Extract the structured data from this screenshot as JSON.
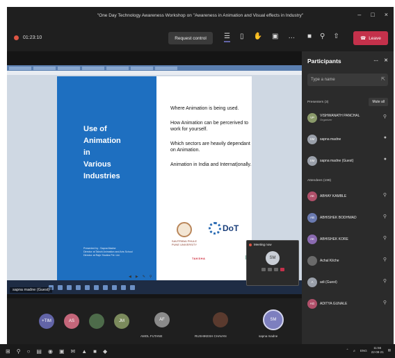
{
  "window": {
    "title": "\"One Day Technology Awareness Workshop on \"Awareness in Animation and Visual effects in Industry\"",
    "controls": [
      "–",
      "□",
      "×"
    ]
  },
  "toolbar": {
    "timer": "01:23:10",
    "request_control": "Request control",
    "leave": "Leave"
  },
  "slide": {
    "title_lines": [
      "Use of",
      "Animation",
      "in",
      "Various",
      "Industries"
    ],
    "bullets": [
      "Where Animation is being used.",
      "How Animation can be percerived to work for yourself.",
      "Which sectors are heavily dependant on Animation.",
      "Animation in India and Internat|onally."
    ],
    "presenter_lines": [
      "Presented by : Sapna Madne",
      "Director at Takshi Animation and Arts School",
      "Director at Rajrr Studios Pvt. Ltd."
    ],
    "ssp_lines": [
      "SAVITRIBAI PHULE",
      "PUNE UNIVERSITY"
    ],
    "dot_text": "DoT",
    "tak_text": "TAKSHA"
  },
  "stage": {
    "name_tag": "sapna madne (Guest)"
  },
  "meet_now": {
    "title": "Meeting now",
    "avatar": "SM"
  },
  "bottom": {
    "avatars": [
      {
        "initials": "+TIM",
        "color": "#6264a7"
      },
      {
        "initials": "AS",
        "color": "#c4667a"
      },
      {
        "initials": "",
        "color": "#4d6b4a"
      },
      {
        "initials": "JM",
        "color": "#7b8a5c"
      }
    ],
    "tiles": [
      {
        "initials": "AF",
        "name": "AMOL FUTANE",
        "color": "#8a8a8a"
      },
      {
        "initials": "",
        "name": "RUSHIKESH CHAVAN",
        "color": "#5a3a2e"
      },
      {
        "initials": "SM",
        "name": "sapna madne",
        "color": "#7d7fbf"
      }
    ]
  },
  "panel": {
    "title": "Participants",
    "search_placeholder": "Type a name",
    "presenters_label": "Presenters (3)",
    "mute_all": "Mute all",
    "presenters": [
      {
        "initials": "VP",
        "name": "VISHWANATH PANCHAL",
        "role": "Organizer",
        "color": "#8a9a6a"
      },
      {
        "initials": "SM",
        "name": "sapna madne",
        "role": "",
        "color": "#9aa0aa"
      },
      {
        "initials": "SM",
        "name": "sapna madne (Guest)",
        "role": "",
        "color": "#9aa0aa"
      }
    ],
    "attendees_label": "Attendees (196)",
    "attendees": [
      {
        "initials": "AK",
        "name": "ABHAY KAMBLE",
        "color": "#b0506a"
      },
      {
        "initials": "AB",
        "name": "ABHISHEK BODHWAD",
        "color": "#6a7ab0"
      },
      {
        "initials": "AK",
        "name": "ABHISHEK KORE",
        "color": "#8a6ab0"
      },
      {
        "initials": "",
        "name": "Achal Kilche",
        "color": "#6a6a6a"
      },
      {
        "initials": "A",
        "name": "adi (Guest)",
        "color": "#9aa0aa"
      },
      {
        "initials": "AG",
        "name": "ADITYA GUNALE",
        "color": "#b0506a"
      }
    ]
  },
  "taskbar": {
    "lang": "ENG",
    "time": "11:56",
    "date": "22-08-21"
  }
}
